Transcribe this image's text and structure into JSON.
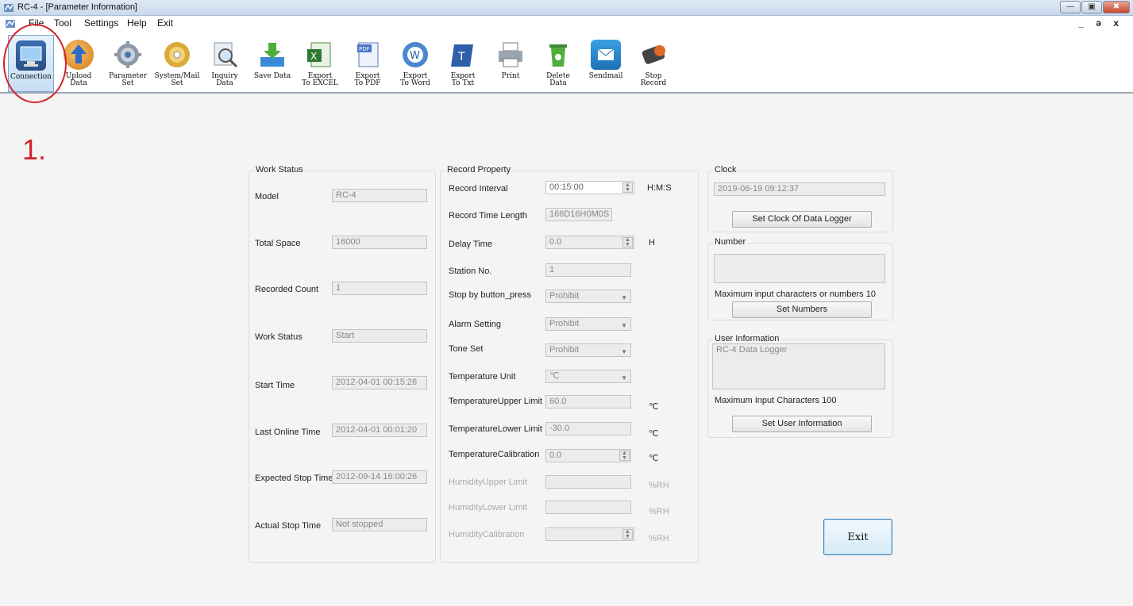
{
  "window": {
    "title": "RC-4 - [Parameter Information]",
    "controls": [
      "minimize",
      "maximize",
      "close"
    ]
  },
  "menu": {
    "items": [
      "File",
      "Tool",
      "Settings",
      "Help",
      "Exit"
    ],
    "mdi_controls": "_ ə x"
  },
  "toolbar": {
    "buttons": [
      {
        "label": "Connection",
        "icon": "monitor-connection-icon"
      },
      {
        "label": "Upload\nData",
        "icon": "upload-arrow-icon"
      },
      {
        "label": "Parameter\nSet",
        "icon": "gear-icon"
      },
      {
        "label": "System/Mail\nSet",
        "icon": "cd-disc-icon"
      },
      {
        "label": "Inquiry\nData",
        "icon": "magnifier-document-icon"
      },
      {
        "label": "Save Data",
        "icon": "save-arrow-icon"
      },
      {
        "label": "Export\nTo EXCEL",
        "icon": "excel-icon"
      },
      {
        "label": "Export\nTo PDF",
        "icon": "pdf-icon"
      },
      {
        "label": "Export\nTo Word",
        "icon": "word-icon"
      },
      {
        "label": "Export\nTo Txt",
        "icon": "txt-icon"
      },
      {
        "label": "Print",
        "icon": "printer-icon"
      },
      {
        "label": "Delete\nData",
        "icon": "trash-icon"
      },
      {
        "label": "Sendmail",
        "icon": "mail-icon"
      },
      {
        "label": "Stop\nRecord",
        "icon": "stop-record-icon"
      }
    ]
  },
  "annotation": {
    "step": "1."
  },
  "work_status": {
    "title": "Work Status",
    "fields": [
      {
        "label": "Model",
        "value": "RC-4"
      },
      {
        "label": "Total Space",
        "value": "16000"
      },
      {
        "label": "Recorded Count",
        "value": "1"
      },
      {
        "label": "Work Status",
        "value": "Start"
      },
      {
        "label": "Start Time",
        "value": "2012-04-01 00:15:26"
      },
      {
        "label": "Last Online Time",
        "value": "2012-04-01 00:01:20"
      },
      {
        "label": "Expected Stop Time",
        "value": "2012-09-14 16:00:26"
      },
      {
        "label": "Actual Stop Time",
        "value": "Not stopped"
      }
    ]
  },
  "record_property": {
    "title": "Record Property",
    "record_interval": {
      "label": "Record Interval",
      "value": "00:15:00",
      "unit": "H:M:S"
    },
    "record_time_length": {
      "label": "Record Time Length",
      "value": "166D16H0M0S"
    },
    "delay_time": {
      "label": "Delay Time",
      "value": "0.0",
      "unit": "H"
    },
    "station_no": {
      "label": "Station No.",
      "value": "1"
    },
    "stop_by_button": {
      "label": "Stop by button_press",
      "value": "Prohibit"
    },
    "alarm_setting": {
      "label": "Alarm Setting",
      "value": "Prohibit"
    },
    "tone_set": {
      "label": "Tone Set",
      "value": "Prohibit"
    },
    "temperature_unit": {
      "label": "Temperature Unit",
      "value": "℃"
    },
    "temp_upper": {
      "label": "TemperatureUpper Limit",
      "value": "60.0",
      "unit": "℃"
    },
    "temp_lower": {
      "label": "TemperatureLower Limit",
      "value": "-30.0",
      "unit": "℃"
    },
    "temp_calibration": {
      "label": "TemperatureCalibration",
      "value": "0.0",
      "unit": "℃"
    },
    "hum_upper": {
      "label": "HumidityUpper Limit",
      "value": "",
      "unit": "%RH"
    },
    "hum_lower": {
      "label": "HumidityLower Limit",
      "value": "",
      "unit": "%RH"
    },
    "hum_calibration": {
      "label": "HumidityCalibration",
      "value": "",
      "unit": "%RH"
    }
  },
  "clock": {
    "title": "Clock",
    "value": "2019-06-19 09:12:37",
    "button": "Set Clock Of Data Logger"
  },
  "number": {
    "title": "Number",
    "value": "",
    "hint": "Maximum input characters or numbers 10",
    "button": "Set Numbers"
  },
  "user_information": {
    "title": "User Information",
    "value": "RC-4 Data Logger",
    "hint": "Maximum Input Characters 100",
    "button": "Set User Information"
  },
  "exit_button": "Exit"
}
